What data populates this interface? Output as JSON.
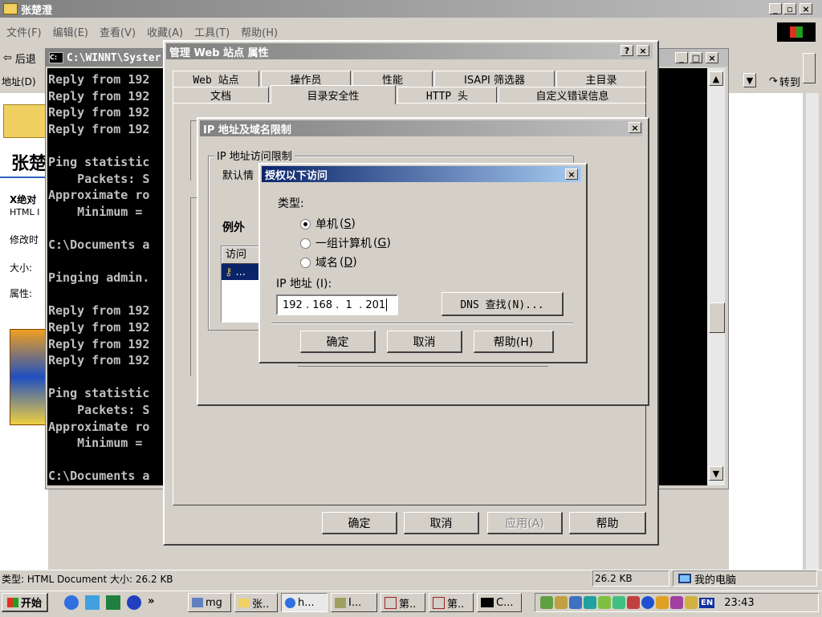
{
  "explorer": {
    "title": "张楚澄",
    "menu": [
      "文件(F)",
      "编辑(E)",
      "查看(V)",
      "收藏(A)",
      "工具(T)",
      "帮助(H)"
    ],
    "back_label": "后退",
    "address_label": "地址(D)",
    "go_label": "转到",
    "folder_title": "张楚",
    "left_texts": [
      "X绝对",
      "HTML I",
      "修改时",
      "大小:",
      "属性:"
    ],
    "status_left": "类型: HTML Document 大小: 26.2 KB",
    "status_size": "26.2 KB",
    "status_zone": "我的电脑"
  },
  "console": {
    "title": "C:\\WINNT\\Syster",
    "lines": [
      "Reply from 192",
      "Reply from 192",
      "Reply from 192",
      "Reply from 192",
      "",
      "Ping statistic",
      "    Packets: S",
      "Approximate ro",
      "    Minimum =",
      "",
      "C:\\Documents a",
      "",
      "Pinging admin.",
      "",
      "Reply from 192",
      "Reply from 192",
      "Reply from 192",
      "Reply from 192",
      "",
      "Ping statistic",
      "    Packets: S",
      "Approximate ro",
      "    Minimum =",
      "",
      "C:\\Documents a"
    ]
  },
  "props_dialog": {
    "title": "管理 Web 站点 属性",
    "help_btn": "?",
    "close_btn": "×",
    "tabs_row1": [
      "Web 站点",
      "操作员",
      "性能",
      "ISAPI 筛选器",
      "主目录"
    ],
    "tabs_row2": [
      "文档",
      "目录安全性",
      "HTTP 头",
      "自定义错误信息"
    ],
    "ok": "确定",
    "cancel": "取消",
    "apply": "应用(A)",
    "help": "帮助"
  },
  "ip_dialog": {
    "title": "IP 地址及域名限制",
    "group_label": "IP 地址访问限制",
    "default_label": "默认情",
    "exceptions_label": "例外",
    "list_header": "访问",
    "list_item": "..."
  },
  "grant_dialog": {
    "title": "授权以下访问",
    "type_label": "类型:",
    "options": [
      {
        "label": "单机",
        "key": "S",
        "selected": true
      },
      {
        "label": "一组计算机",
        "key": "G",
        "selected": false
      },
      {
        "label": "域名",
        "key": "D",
        "selected": false
      }
    ],
    "ip_label": "IP 地址 (I):",
    "ip_value": "192 . 168 .  1  . 201",
    "dns_btn": "DNS 查找(N)...",
    "ok": "确定",
    "cancel": "取消",
    "help": "帮助(H)"
  },
  "taskbar": {
    "start": "开始",
    "items": [
      "mg",
      "张..",
      "h...",
      "I...",
      "第..",
      "第..",
      "C..."
    ],
    "lang": "EN",
    "clock": "23:43"
  },
  "colors": {
    "title_active": "#0a246a",
    "title_gradient_end": "#a6caf0",
    "console_bg": "#000000",
    "console_fg": "#c0c0c0",
    "face": "#d4d0c8"
  }
}
